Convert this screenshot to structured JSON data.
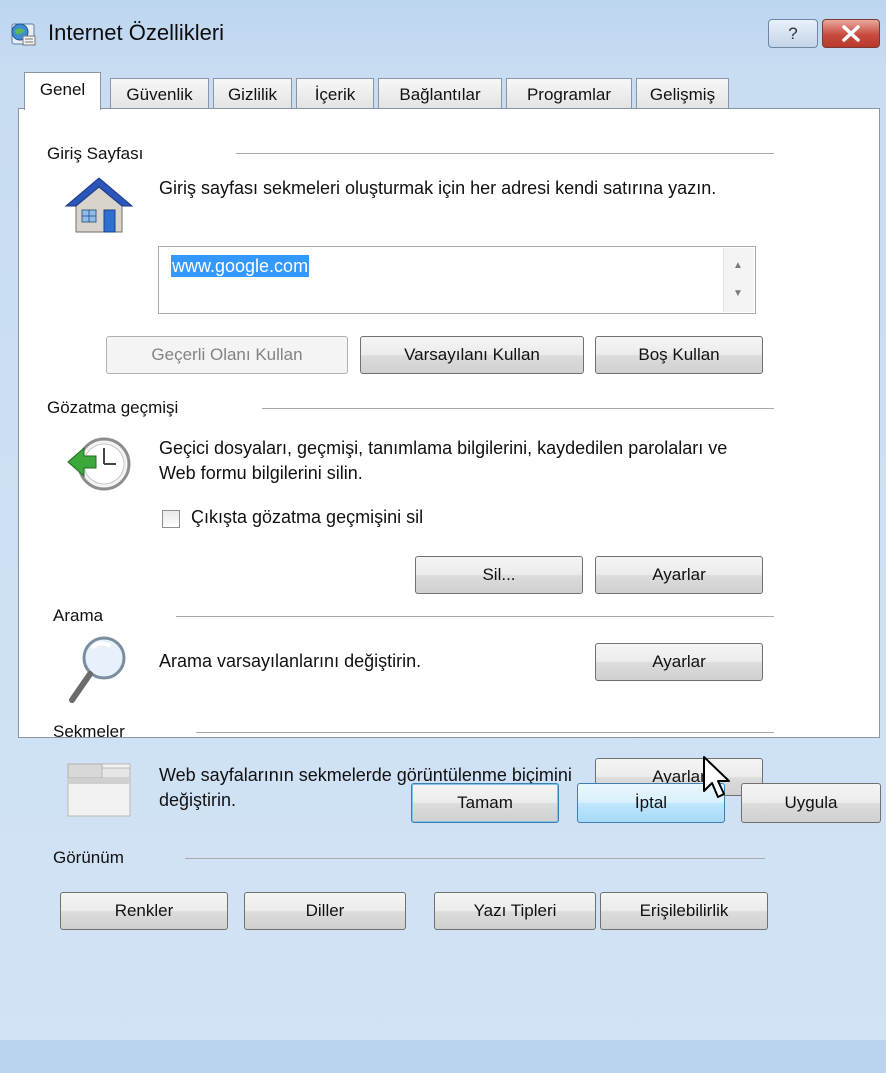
{
  "window": {
    "title": "Internet Özellikleri",
    "help_label": "?",
    "close_icon": "close-icon",
    "colors": {
      "frame": "#c8dcf2",
      "close": "#c74b3e",
      "selection": "#3399ff"
    }
  },
  "tabs": [
    {
      "label": "Genel",
      "active": true
    },
    {
      "label": "Güvenlik"
    },
    {
      "label": "Gizlilik"
    },
    {
      "label": "İçerik"
    },
    {
      "label": "Bağlantılar"
    },
    {
      "label": "Programlar"
    },
    {
      "label": "Gelişmiş"
    }
  ],
  "home": {
    "label": "Giriş Sayfası",
    "icon": "house-icon",
    "description": "Giriş sayfası sekmeleri oluşturmak için her adresi kendi satırına yazın.",
    "value": "www.google.com",
    "buttons": {
      "current": "Geçerli Olanı Kullan",
      "default": "Varsayılanı Kullan",
      "blank": "Boş Kullan"
    }
  },
  "history": {
    "label": "Gözatma geçmişi",
    "icon": "history-clock-icon",
    "description": "Geçici dosyaları, geçmişi, tanımlama bilgilerini, kaydedilen parolaları ve Web formu bilgilerini silin.",
    "checkbox_label": "Çıkışta gözatma geçmişini sil",
    "checkbox_checked": false,
    "buttons": {
      "delete": "Sil...",
      "settings": "Ayarlar"
    }
  },
  "search": {
    "label": "Arama",
    "icon": "magnifier-icon",
    "description": "Arama varsayılanlarını değiştirin.",
    "settings": "Ayarlar"
  },
  "tabs_group": {
    "label": "Sekmeler",
    "icon": "tabs-window-icon",
    "description": "Web sayfalarının sekmelerde görüntülenme biçimini değiştirin.",
    "settings": "Ayarlar"
  },
  "appearance": {
    "label": "Görünüm",
    "buttons": {
      "colors": "Renkler",
      "languages": "Diller",
      "fonts": "Yazı Tipleri",
      "accessibility": "Erişilebilirlik"
    }
  },
  "footer": {
    "ok": "Tamam",
    "cancel": "İptal",
    "apply": "Uygula"
  }
}
